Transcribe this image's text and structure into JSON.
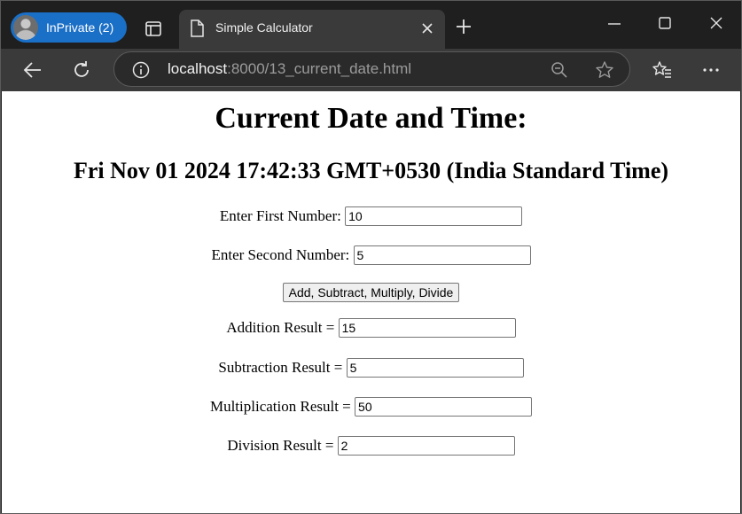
{
  "browser": {
    "profile_label": "InPrivate (2)",
    "tab_title": "Simple Calculator",
    "url_host": "localhost",
    "url_rest": ":8000/13_current_date.html"
  },
  "page": {
    "heading": "Current Date and Time:",
    "datetime": "Fri Nov 01 2024 17:42:33 GMT+0530 (India Standard Time)",
    "first_label": "Enter First Number:",
    "first_value": "10",
    "second_label": "Enter Second Number:",
    "second_value": "5",
    "calc_button": "Add, Subtract, Multiply, Divide",
    "add_label": "Addition Result =",
    "add_value": "15",
    "sub_label": "Subtraction Result =",
    "sub_value": "5",
    "mul_label": "Multiplication Result =",
    "mul_value": "50",
    "div_label": "Division Result =",
    "div_value": "2"
  }
}
